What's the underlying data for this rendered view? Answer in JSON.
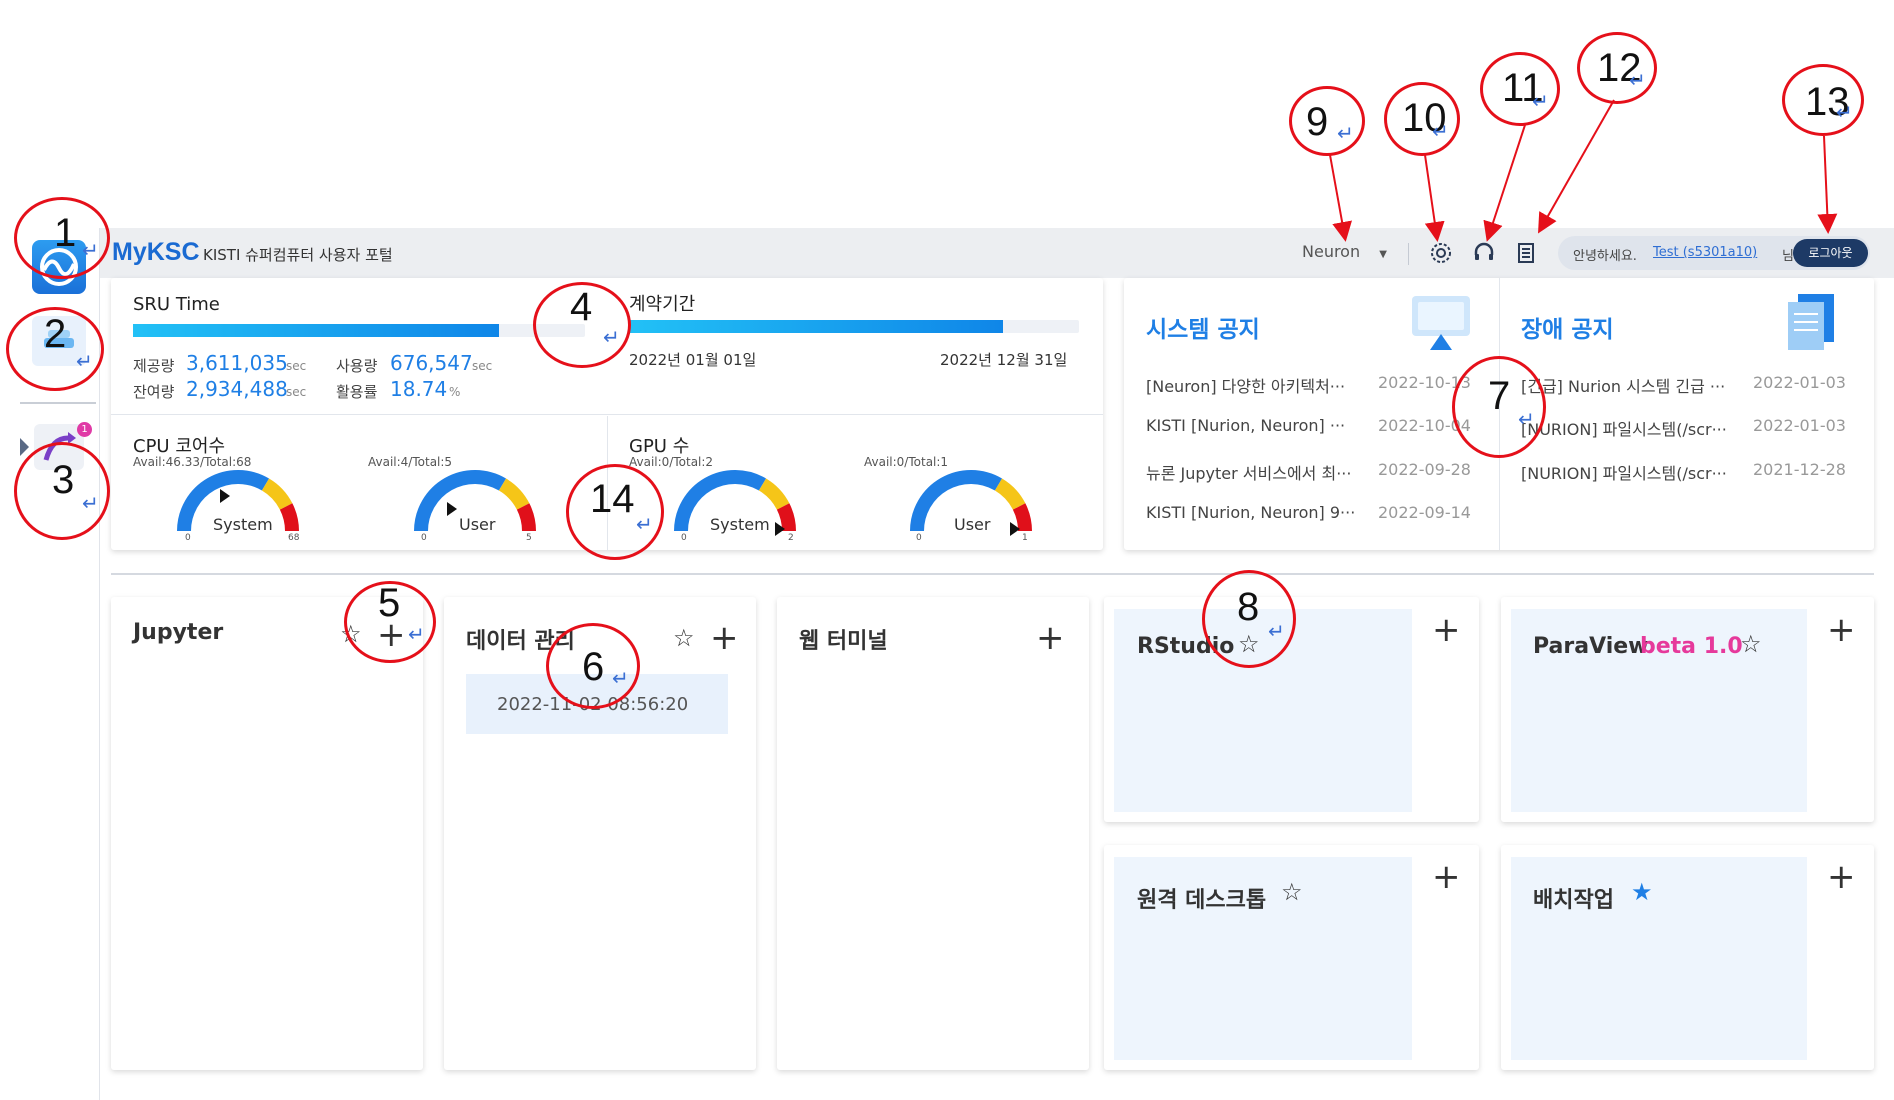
{
  "header": {
    "brand": "MyKSC",
    "subtitle": "KISTI 슈퍼컴퓨터 사용자 포털",
    "system_select": "Neuron",
    "greeting": "안녕하세요.",
    "user_link": "Test (s5301a10)",
    "user_suffix": "님",
    "logout": "로그아웃"
  },
  "sidebar": {
    "badge_count": "1"
  },
  "sru": {
    "title": "SRU Time",
    "provided_label": "제공량",
    "provided_value": "3,611,035",
    "used_label": "사용량",
    "used_value": "676,547",
    "remaining_label": "잔여량",
    "remaining_value": "2,934,488",
    "utilization_label": "활용률",
    "utilization_value": "18.74",
    "unit_sec": "sec",
    "unit_pct": "%",
    "progress": 0.81
  },
  "contract": {
    "title": "계약기간",
    "start": "2022년 01월 01일",
    "end": "2022년 12월 31일",
    "progress": 0.83
  },
  "cpu": {
    "title": "CPU 코어수",
    "system": {
      "avail": "Avail:46.33/Total:68",
      "label": "System",
      "min": "0",
      "max": "68"
    },
    "user": {
      "avail": "Avail:4/Total:5",
      "label": "User",
      "min": "0",
      "max": "5"
    }
  },
  "gpu": {
    "title": "GPU 수",
    "system": {
      "avail": "Avail:0/Total:2",
      "label": "System",
      "min": "0",
      "max": "2"
    },
    "user": {
      "avail": "Avail:0/Total:1",
      "label": "User",
      "min": "0",
      "max": "1"
    }
  },
  "system_notice": {
    "title": "시스템 공지",
    "items": [
      {
        "text": "[Neuron] 다양한 아키텍처···",
        "date": "2022-10-13"
      },
      {
        "text": "KISTI [Nurion, Neuron] ···",
        "date": "2022-10-04"
      },
      {
        "text": "뉴론 Jupyter 서비스에서 최···",
        "date": "2022-09-28"
      },
      {
        "text": "KISTI [Nurion, Neuron] 9···",
        "date": "2022-09-14"
      }
    ]
  },
  "fault_notice": {
    "title": "장애 공지",
    "items": [
      {
        "text": "[긴급] Nurion 시스템 긴급 ···",
        "date": "2022-01-03"
      },
      {
        "text": "[NURION] 파일시스템(/scr···",
        "date": "2022-01-03"
      },
      {
        "text": "[NURION] 파일시스템(/scr···",
        "date": "2021-12-28"
      }
    ]
  },
  "apps": {
    "jupyter": "Jupyter",
    "data": "데이터 관리",
    "data_time": "2022-11-02 08:56:20",
    "web_terminal": "웹 터미널",
    "rstudio": "RStudio",
    "paraview": "ParaView",
    "paraview_beta": "beta 1.0",
    "remote_desktop": "원격 데스크톱",
    "batch": "배치작업",
    "plus": "+",
    "star_empty": "☆",
    "star_filled": "★"
  },
  "callouts": [
    "1",
    "2",
    "3",
    "4",
    "5",
    "6",
    "7",
    "8",
    "9",
    "10",
    "11",
    "12",
    "13",
    "14"
  ],
  "colors": {
    "accent": "#1f7fe5",
    "callout": "#e5101a",
    "logout_bg": "#1d3a66",
    "beta": "#e6399b"
  }
}
